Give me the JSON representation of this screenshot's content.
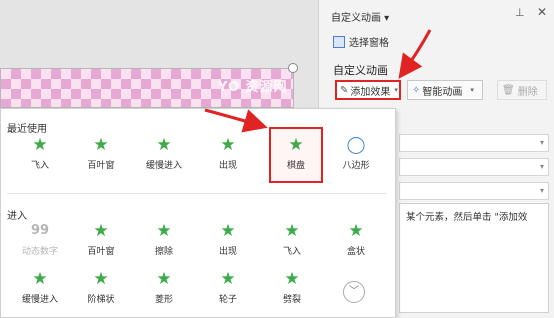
{
  "watermark": "YO 资源网",
  "pane": {
    "title": "自定义动画",
    "selection_pane": "选择窗格",
    "section_title": "自定义动画",
    "add_effect": "添加效果",
    "smart_animation": "智能动画",
    "delete": "删除",
    "hint": "某个元素，然后单击 \"添加效"
  },
  "gallery": {
    "recent_title": "最近使用",
    "recent": [
      {
        "label": "飞入",
        "icon": "fly-in-icon"
      },
      {
        "label": "百叶窗",
        "icon": "blinds-icon"
      },
      {
        "label": "缓慢进入",
        "icon": "slow-enter-icon"
      },
      {
        "label": "出现",
        "icon": "appear-icon"
      },
      {
        "label": "棋盘",
        "icon": "checkerboard-icon"
      },
      {
        "label": "八边形",
        "icon": "octagon-icon"
      }
    ],
    "enter_title": "进入",
    "enter_row1": [
      {
        "label": "动态数字",
        "icon": "dynamic-number-icon"
      },
      {
        "label": "百叶窗",
        "icon": "blinds-icon"
      },
      {
        "label": "擦除",
        "icon": "wipe-icon"
      },
      {
        "label": "出现",
        "icon": "appear-icon"
      },
      {
        "label": "飞入",
        "icon": "fly-in-icon"
      },
      {
        "label": "盒状",
        "icon": "box-icon"
      }
    ],
    "enter_row2": [
      {
        "label": "缓慢进入",
        "icon": "slow-enter-icon"
      },
      {
        "label": "阶梯状",
        "icon": "stairs-icon"
      },
      {
        "label": "菱形",
        "icon": "diamond-icon"
      },
      {
        "label": "轮子",
        "icon": "wheel-icon"
      },
      {
        "label": "劈裂",
        "icon": "split-icon"
      }
    ]
  },
  "colors": {
    "accent": "#3faa48",
    "highlight": "#e02424"
  }
}
